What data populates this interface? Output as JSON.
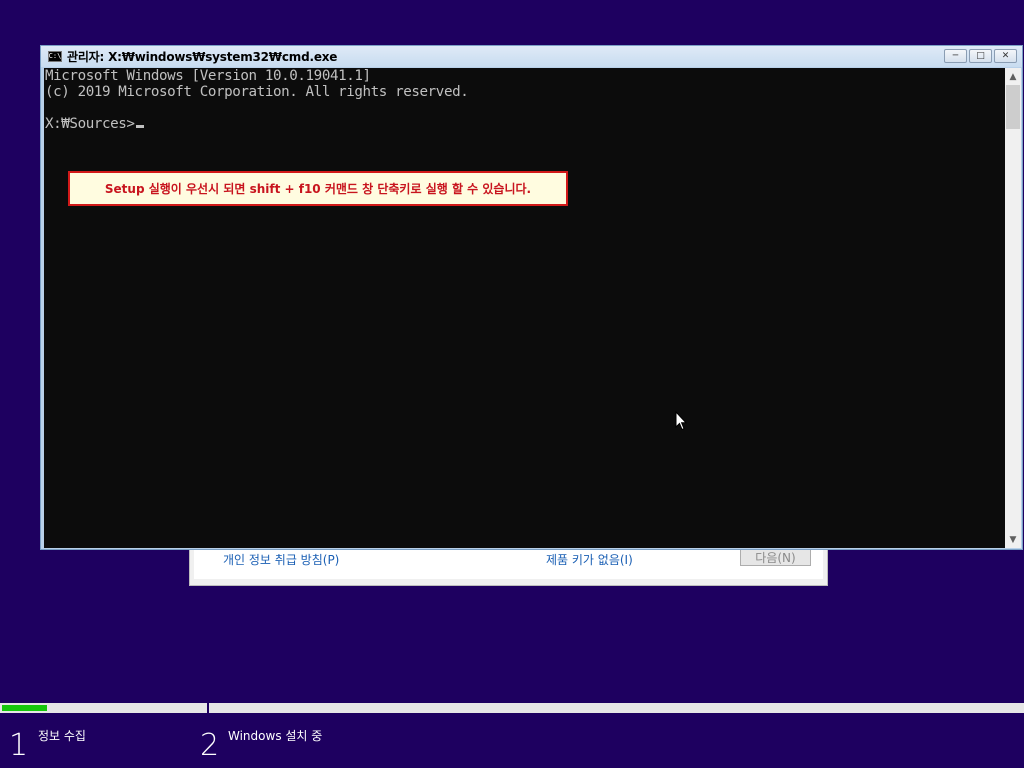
{
  "setup": {
    "privacy_link": "개인 정보 취급 방침(P)",
    "no_key_link": "제품 키가 없음(I)",
    "next_button": "다음(N)"
  },
  "cmd": {
    "title": "관리자: X:₩windows₩system32₩cmd.exe",
    "icon_label": "C:\\",
    "buttons": {
      "minimize": "─",
      "maximize": "□",
      "close": "✕"
    },
    "lines": [
      "Microsoft Windows [Version 10.0.19041.1]",
      "(c) 2019 Microsoft Corporation. All rights reserved.",
      "",
      "X:₩Sources>"
    ],
    "scroll_up": "▲",
    "scroll_down": "▼"
  },
  "annotation": {
    "text": "Setup 실행이 우선시 되면 shift + f10 커맨드 창 단축키로 실행 할 수 있습니다."
  },
  "progress": {
    "step1_fill": 0.22,
    "steps": [
      {
        "number": "1",
        "label": "정보 수집"
      },
      {
        "number": "2",
        "label": "Windows 설치 중"
      }
    ]
  },
  "colors": {
    "desktop": "#1e0060",
    "progress_green": "#16c60c",
    "annotation_red": "#d21919",
    "annotation_bg": "#fffce0"
  },
  "icons": [
    "cmd-icon",
    "minimize-icon",
    "maximize-icon",
    "close-icon",
    "scroll-up-icon",
    "scroll-down-icon",
    "mouse-pointer-icon"
  ]
}
